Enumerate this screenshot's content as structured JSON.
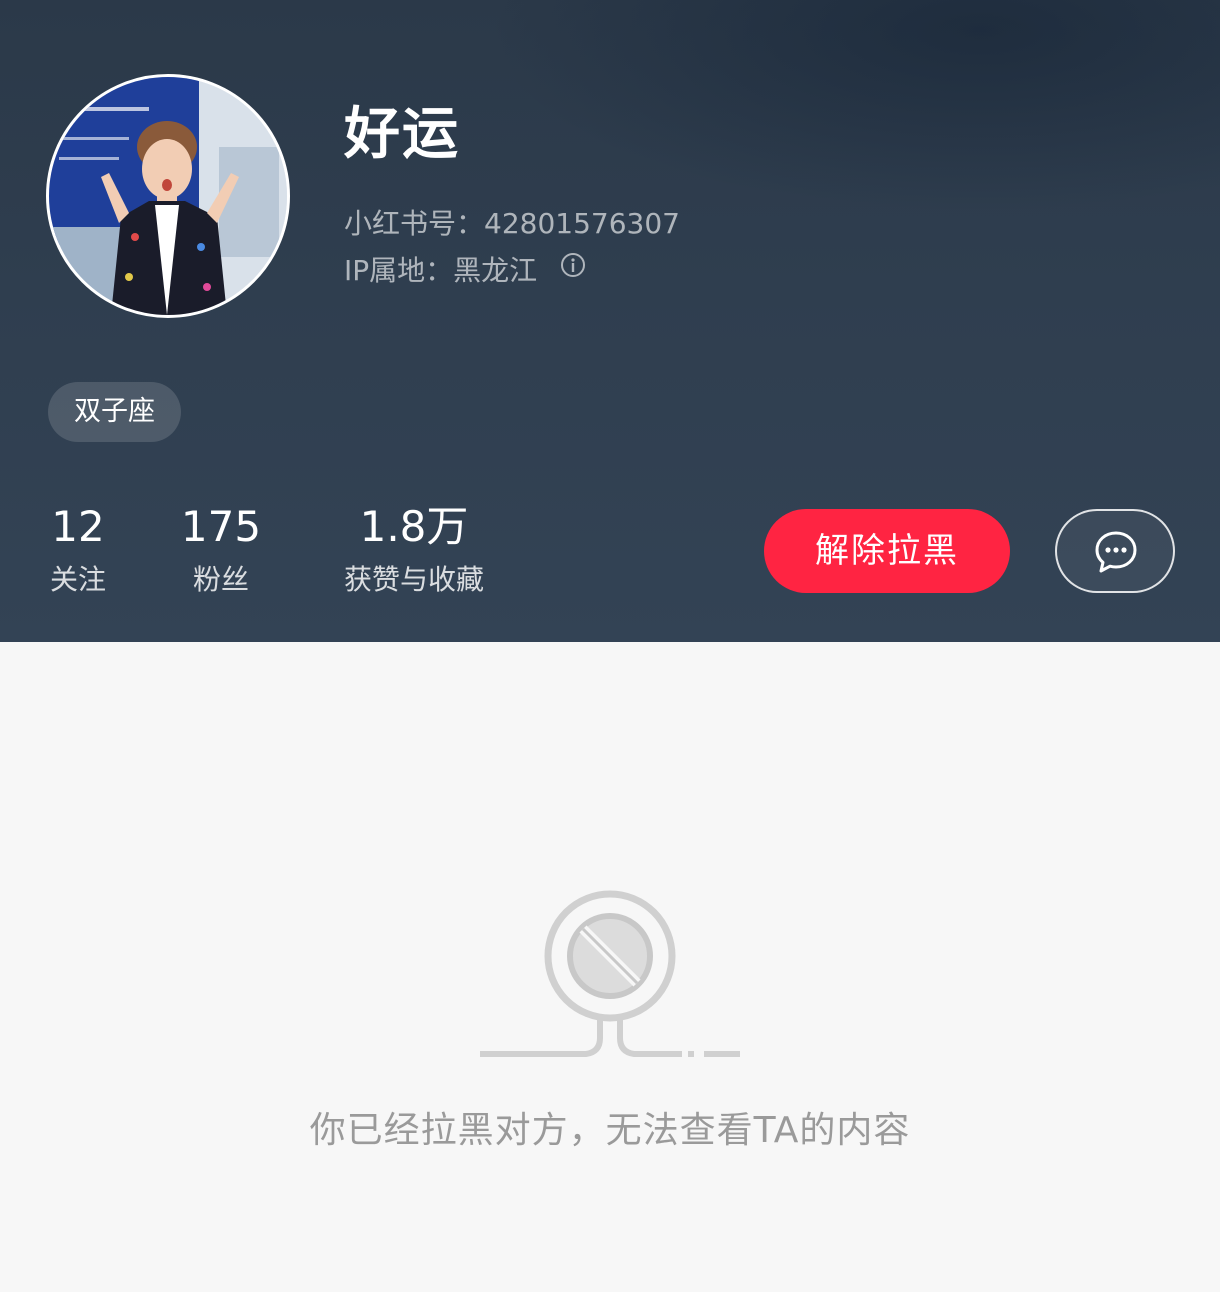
{
  "profile": {
    "username": "好运",
    "id_line": "小红书号：42801576307",
    "ip_line": "IP属地：黑龙江",
    "tag": "双子座"
  },
  "stats": [
    {
      "value": "12",
      "label": "关注"
    },
    {
      "value": "175",
      "label": "粉丝"
    },
    {
      "value": "1.8万",
      "label": "获赞与收藏"
    }
  ],
  "actions": {
    "unblock_label": "解除拉黑",
    "message_icon": "chat-bubble-icon"
  },
  "blocked": {
    "icon": "blocked-sign-icon",
    "message": "你已经拉黑对方，无法查看TA的内容"
  },
  "colors": {
    "header_bg": "#2f3e4f",
    "accent_red": "#ff2442",
    "page_bg": "#f7f7f7",
    "muted_text": "#9a9a9a"
  }
}
